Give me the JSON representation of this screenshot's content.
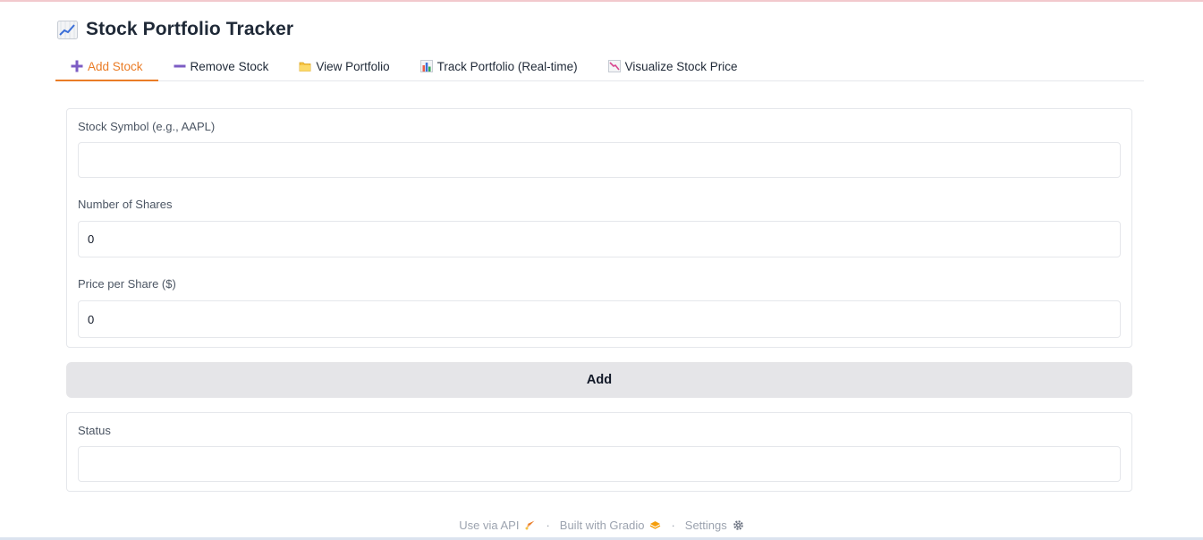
{
  "app": {
    "title": "Stock Portfolio Tracker",
    "title_icon": "chart-increasing-icon"
  },
  "tabs": [
    {
      "label": "Add Stock",
      "icon": "plus-icon",
      "active": true
    },
    {
      "label": "Remove Stock",
      "icon": "minus-icon",
      "active": false
    },
    {
      "label": "View Portfolio",
      "icon": "folder-icon",
      "active": false
    },
    {
      "label": "Track Portfolio (Real-time)",
      "icon": "bar-chart-icon",
      "active": false
    },
    {
      "label": "Visualize Stock Price",
      "icon": "chart-decreasing-icon",
      "active": false
    }
  ],
  "form": {
    "symbol_label": "Stock Symbol (e.g., AAPL)",
    "symbol_value": "",
    "shares_label": "Number of Shares",
    "shares_value": "0",
    "price_label": "Price per Share ($)",
    "price_value": "0"
  },
  "add_button_label": "Add",
  "status": {
    "label": "Status",
    "value": ""
  },
  "footer": {
    "api_label": "Use via API",
    "built_label": "Built with Gradio",
    "settings_label": "Settings",
    "separator": "·"
  },
  "colors": {
    "accent": "#ea7c26",
    "button_bg": "#e5e5e8",
    "border": "#e5e7eb"
  }
}
